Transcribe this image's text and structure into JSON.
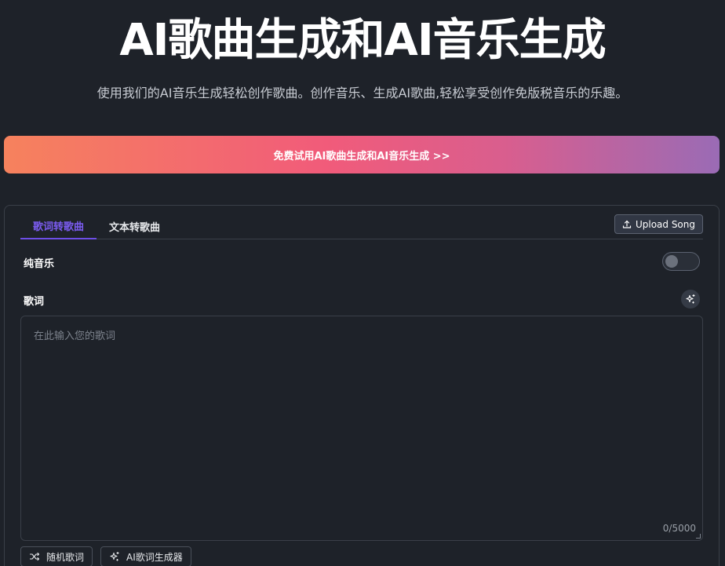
{
  "hero": {
    "title": "AI歌曲生成和AI音乐生成",
    "subtitle": "使用我们的AI音乐生成轻松创作歌曲。创作音乐、生成AI歌曲,轻松享受创作免版税音乐的乐趣。"
  },
  "cta": {
    "label": "免费试用AI歌曲生成和AI音乐生成 >>",
    "gradient_colors": [
      "#f6825d",
      "#f15b7a",
      "#d95e8e",
      "#9a6bb5"
    ]
  },
  "tabs": [
    {
      "label": "歌词转歌曲",
      "active": true
    },
    {
      "label": "文本转歌曲",
      "active": false
    }
  ],
  "upload": {
    "label": "Upload Song",
    "icon": "upload-icon"
  },
  "instrumental": {
    "label": "纯音乐",
    "enabled": false
  },
  "lyrics": {
    "label": "歌词",
    "placeholder": "在此输入您的歌词",
    "value": "",
    "counter": "0/5000",
    "assist_icon": "sparkles-icon"
  },
  "actions": {
    "random_lyrics": {
      "label": "随机歌词",
      "icon": "shuffle-icon"
    },
    "ai_lyrics_generator": {
      "label": "AI歌词生成器",
      "icon": "sparkles-icon"
    }
  },
  "colors": {
    "background": "#1e2229",
    "accent": "#6d4ee6",
    "border": "#3a3f48"
  }
}
